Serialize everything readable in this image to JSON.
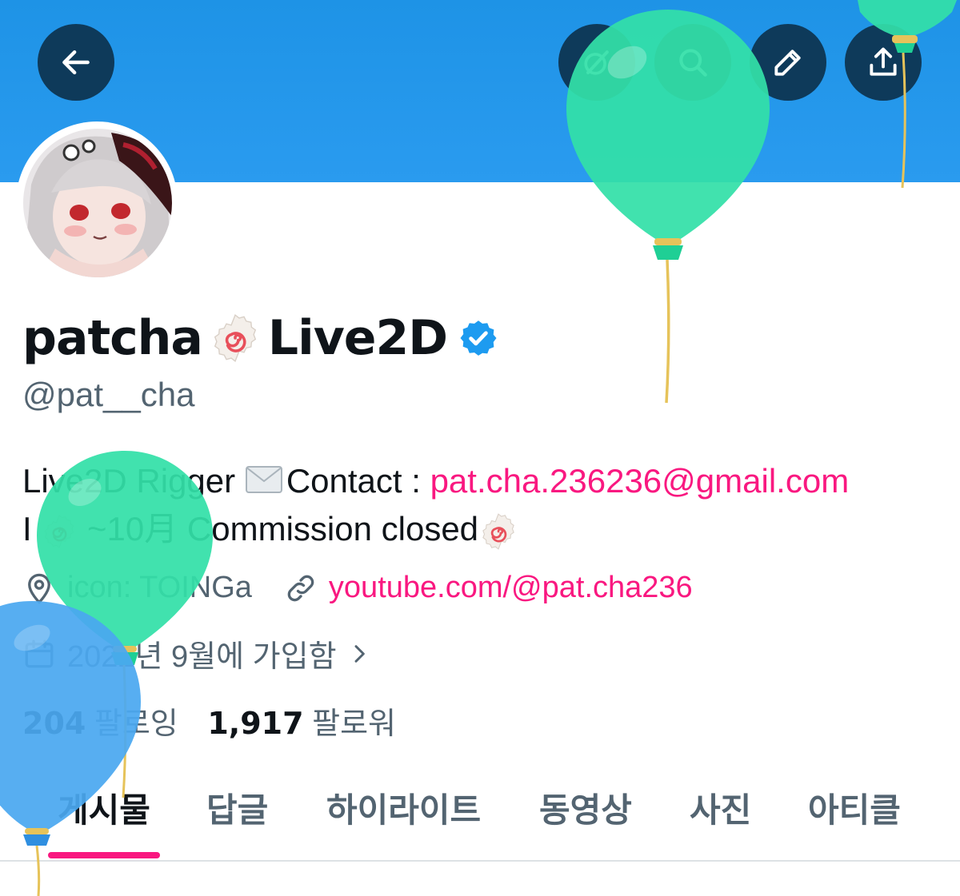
{
  "profile": {
    "name_part1": "patcha",
    "name_part2": "Live2D",
    "handle": "@pat__cha",
    "bio_line1_prefix": "Live2D Rigger ",
    "bio_line1_contact": "Contact : ",
    "bio_email": "pat.cha.236236@gmail.com",
    "bio_line2_prefix": "I ",
    "bio_line2_mid": " ~10月 Commission closed",
    "location": "icon: TOINGa",
    "website": "youtube.com/@pat.cha236",
    "joined": "2022년 9월에 가입함",
    "following_count": "204",
    "following_label": "팔로잉",
    "followers_count": "1,917",
    "followers_label": "팔로워"
  },
  "tabs": [
    {
      "label": "게시물"
    },
    {
      "label": "답글"
    },
    {
      "label": "하이라이트"
    },
    {
      "label": "동영상"
    },
    {
      "label": "사진"
    },
    {
      "label": "아티클"
    }
  ],
  "icons": {
    "back": "arrow-left-icon",
    "grok": "grok-icon",
    "search": "search-icon",
    "edit": "pencil-icon",
    "share": "share-icon",
    "verified": "verified-badge-icon",
    "location": "location-pin-icon",
    "link": "link-icon",
    "calendar": "calendar-icon",
    "mail": "envelope-icon",
    "fishcake": "narutomaki-icon"
  },
  "colors": {
    "banner": "#1e93e6",
    "accent": "#f91880",
    "verified": "#1d9bf0",
    "balloon_green": "#33e0a8",
    "balloon_blue": "#4aa8f0"
  }
}
